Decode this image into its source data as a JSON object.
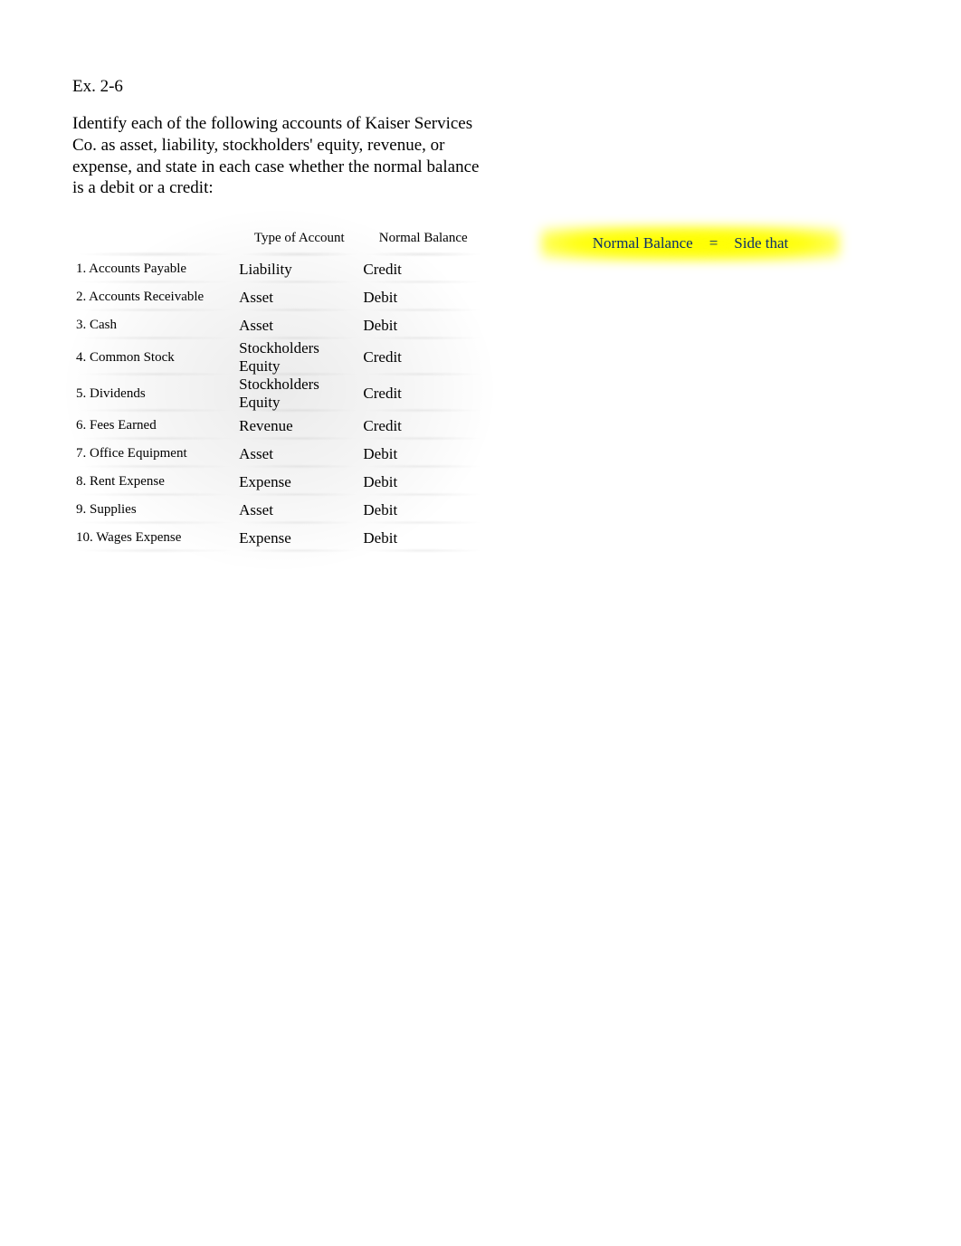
{
  "exercise": {
    "title": "Ex. 2-6",
    "instructions": " Identify each of the following accounts of Kaiser Services Co. as asset, liability, stockholders' equity, revenue, or expense, and state in each case whether the normal balance is a debit or a credit:"
  },
  "table": {
    "headers": {
      "account": "",
      "type": "Type of Account",
      "balance": "Normal Balance"
    },
    "rows": [
      {
        "account": "1. Accounts Payable",
        "type": "Liability",
        "balance": "Credit"
      },
      {
        "account": "2. Accounts Receivable",
        "type": "Asset",
        "balance": "Debit"
      },
      {
        "account": "3. Cash",
        "type": "Asset",
        "balance": "Debit"
      },
      {
        "account": "4. Common Stock",
        "type": "Stockholders Equity",
        "balance": "Credit"
      },
      {
        "account": "5. Dividends",
        "type": "Stockholders Equity",
        "balance": "Credit"
      },
      {
        "account": "6. Fees Earned",
        "type": "Revenue",
        "balance": "Credit"
      },
      {
        "account": "7. Office Equipment",
        "type": "Asset",
        "balance": "Debit"
      },
      {
        "account": "8. Rent Expense",
        "type": "Expense",
        "balance": "Debit"
      },
      {
        "account": "9. Supplies",
        "type": "Asset",
        "balance": "Debit"
      },
      {
        "account": "10. Wages Expense",
        "type": "Expense",
        "balance": "Debit"
      }
    ]
  },
  "note": {
    "left": "Normal Balance",
    "eq": "=",
    "right": "Side that"
  }
}
